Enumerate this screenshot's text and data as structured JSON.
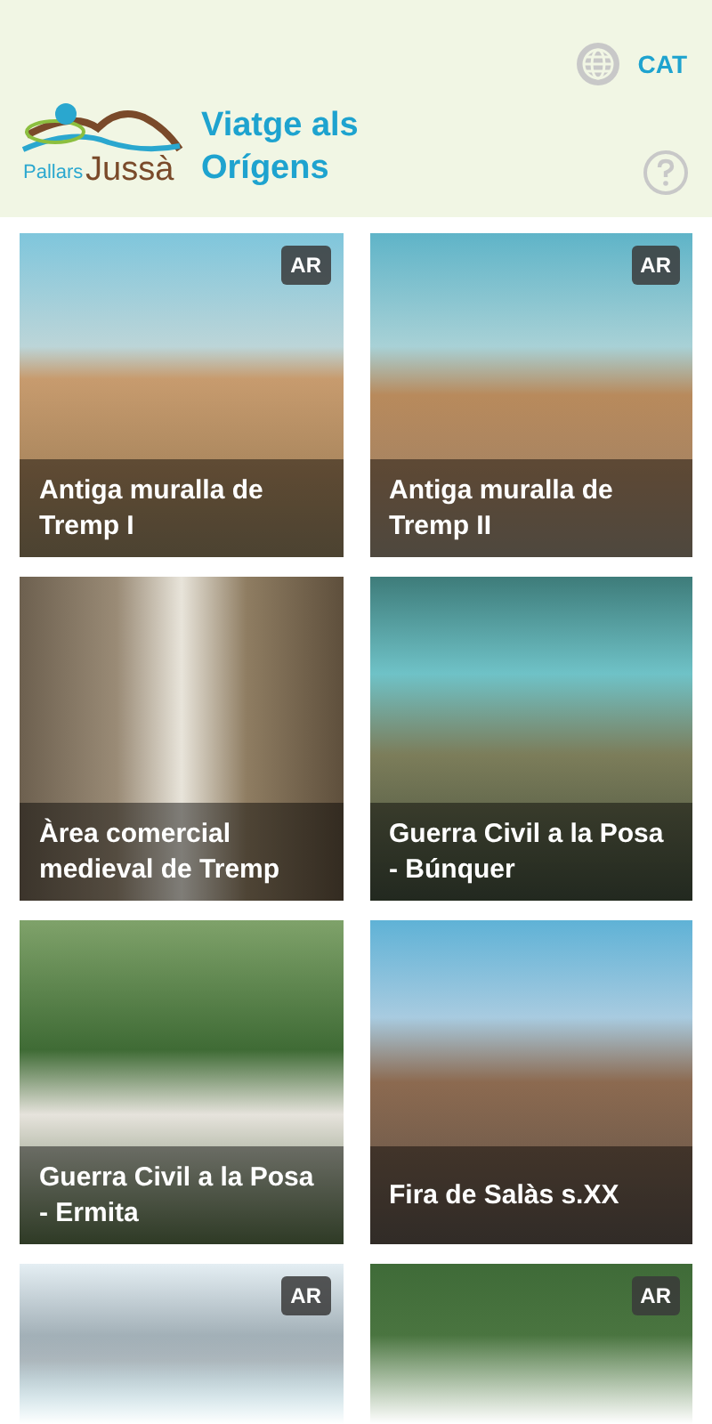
{
  "header": {
    "logo": {
      "line1": "Pallars",
      "line2": "Jussà"
    },
    "title": "Viatge als Orígens",
    "language": "CAT"
  },
  "cards": [
    {
      "title": "Antiga muralla de Tremp I",
      "badge": "AR"
    },
    {
      "title": "Antiga muralla de Tremp II",
      "badge": "AR"
    },
    {
      "title": "Àrea comercial medieval de Tremp"
    },
    {
      "title": "Guerra Civil a la Posa - Búnquer"
    },
    {
      "title": "Guerra Civil a la Posa - Ermita"
    },
    {
      "title": "Fira de Salàs s.XX"
    },
    {
      "badge": "AR"
    },
    {
      "badge": "AR"
    }
  ]
}
